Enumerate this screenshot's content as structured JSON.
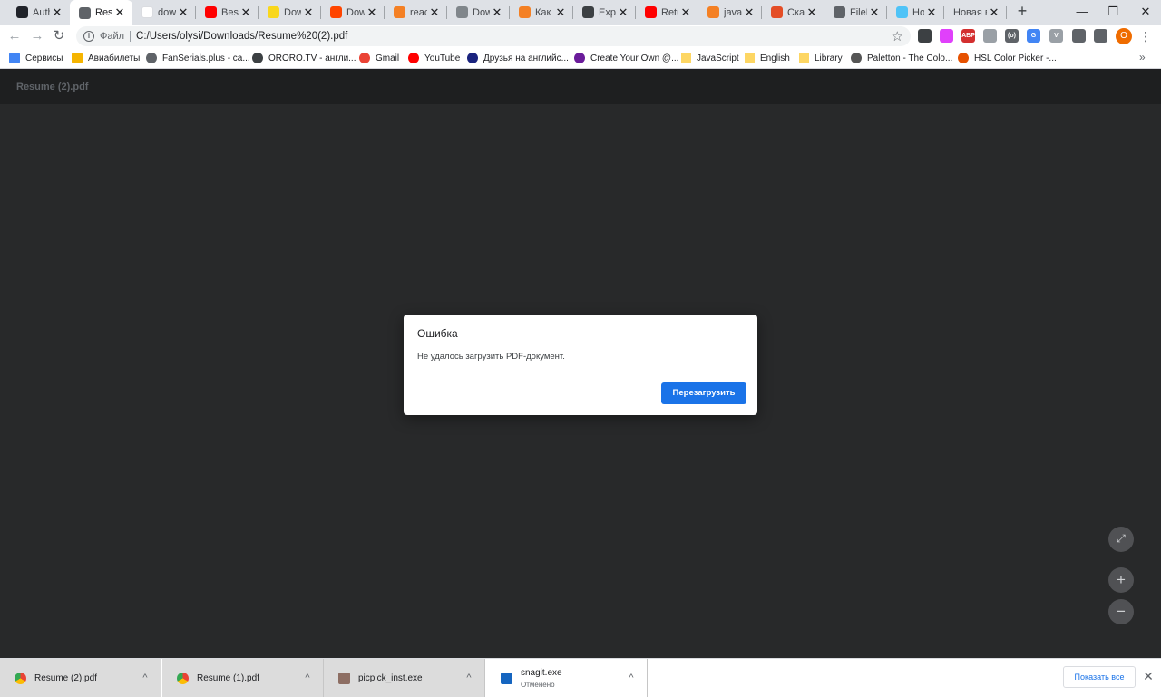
{
  "tabs": [
    {
      "label": "Auth",
      "favicon": "react-icon",
      "color": "#20232a"
    },
    {
      "label": "Resu",
      "favicon": "globe-icon",
      "color": "#5f6368"
    },
    {
      "label": "dow",
      "favicon": "google-icon",
      "color": "#ffffff"
    },
    {
      "label": "Best",
      "favicon": "youtube-icon",
      "color": "#ff0000"
    },
    {
      "label": "Dow",
      "favicon": "yellow-site-icon",
      "color": "#f9d71c"
    },
    {
      "label": "Dow",
      "favicon": "reddit-icon",
      "color": "#ff4500"
    },
    {
      "label": "react",
      "favicon": "stackoverflow-icon",
      "color": "#f48024"
    },
    {
      "label": "Dow",
      "favicon": "doc-icon",
      "color": "#80868b"
    },
    {
      "label": "Как с",
      "favicon": "stackoverflow-icon",
      "color": "#f48024"
    },
    {
      "label": "Expr",
      "favicon": "express-icon",
      "color": "#3c4043"
    },
    {
      "label": "Retu",
      "favicon": "youtube-icon",
      "color": "#ff0000"
    },
    {
      "label": "javas",
      "favicon": "stackoverflow-icon",
      "color": "#f48024"
    },
    {
      "label": "Скач",
      "favicon": "code-icon",
      "color": "#e44d26"
    },
    {
      "label": "FileN",
      "favicon": "globe-icon",
      "color": "#5f6368"
    },
    {
      "label": "How",
      "favicon": "face-icon",
      "color": "#4fc3f7"
    },
    {
      "label": "Новая вк",
      "favicon": "",
      "color": ""
    }
  ],
  "tab_close_glyph": "✕",
  "new_tab_glyph": "+",
  "window": {
    "minimize": "—",
    "restore": "❐",
    "close": "✕"
  },
  "nav": {
    "back": "←",
    "forward": "→",
    "reload": "↻"
  },
  "omnibox": {
    "scheme_label": "Файл",
    "url": "C:/Users/olysi/Downloads/Resume%20(2).pdf",
    "star": "☆"
  },
  "extensions": [
    {
      "name": "extension-dark-icon",
      "color": "#3c4043",
      "text": ""
    },
    {
      "name": "extension-pink-icon",
      "color": "#e040fb",
      "text": ""
    },
    {
      "name": "adblock-icon",
      "color": "#d32f2f",
      "text": "ABP"
    },
    {
      "name": "extension-box-icon",
      "color": "#9aa0a6",
      "text": ""
    },
    {
      "name": "extension-brackets-icon",
      "color": "#5f6368",
      "text": "(o)"
    },
    {
      "name": "translate-icon",
      "color": "#4285f4",
      "text": "G"
    },
    {
      "name": "vue-devtools-icon",
      "color": "#9aa0a6",
      "text": "V"
    },
    {
      "name": "puzzle-icon",
      "color": "#5f6368",
      "text": ""
    },
    {
      "name": "reading-list-icon",
      "color": "#5f6368",
      "text": ""
    }
  ],
  "profile_initial": "O",
  "menu_glyph": "⋮",
  "bookmarks": [
    {
      "label": "Сервисы",
      "icon": "apps-grid-icon",
      "color": "#4285f4"
    },
    {
      "label": "Авиабилеты",
      "icon": "plane-icon",
      "color": "#f5b400"
    },
    {
      "label": "FanSerials.plus - са...",
      "icon": "globe-icon",
      "color": "#5f6368"
    },
    {
      "label": "ORORO.TV - англи...",
      "icon": "ororo-icon",
      "color": "#3c4043"
    },
    {
      "label": "Gmail",
      "icon": "gmail-icon",
      "color": "#ea4335"
    },
    {
      "label": "YouTube",
      "icon": "youtube-icon",
      "color": "#ff0000"
    },
    {
      "label": "Друзья на английс...",
      "icon": "uk-flag-icon",
      "color": "#1a237e"
    },
    {
      "label": "Create Your Own @...",
      "icon": "brain-icon",
      "color": "#6a1b9a"
    },
    {
      "label": "JavaScript",
      "icon": "folder-icon",
      "color": "#fdd663"
    },
    {
      "label": "English",
      "icon": "folder-icon",
      "color": "#fdd663"
    },
    {
      "label": "Library",
      "icon": "folder-icon",
      "color": "#fdd663"
    },
    {
      "label": "Paletton - The Colo...",
      "icon": "paletton-icon",
      "color": "#555555"
    },
    {
      "label": "HSL Color Picker -...",
      "icon": "hsl-icon",
      "color": "#e65100"
    }
  ],
  "bookmarks_more": "»",
  "pdf": {
    "title": "Resume (2).pdf"
  },
  "dialog": {
    "title": "Ошибка",
    "message": "Не удалось загрузить PDF-документ.",
    "button": "Перезагрузить"
  },
  "zoom_controls": {
    "fit": "⤢",
    "zoom_in": "+",
    "zoom_out": "−"
  },
  "downloads": [
    {
      "name": "Resume (2).pdf",
      "status": "",
      "icon": "chrome-icon"
    },
    {
      "name": "Resume (1).pdf",
      "status": "",
      "icon": "chrome-icon"
    },
    {
      "name": "picpick_inst.exe",
      "status": "",
      "icon": "picpick-icon"
    },
    {
      "name": "snagit.exe",
      "status": "Отменено",
      "icon": "snagit-icon"
    }
  ],
  "download_chevron": "^",
  "show_all": "Показать все",
  "downloads_close": "✕"
}
